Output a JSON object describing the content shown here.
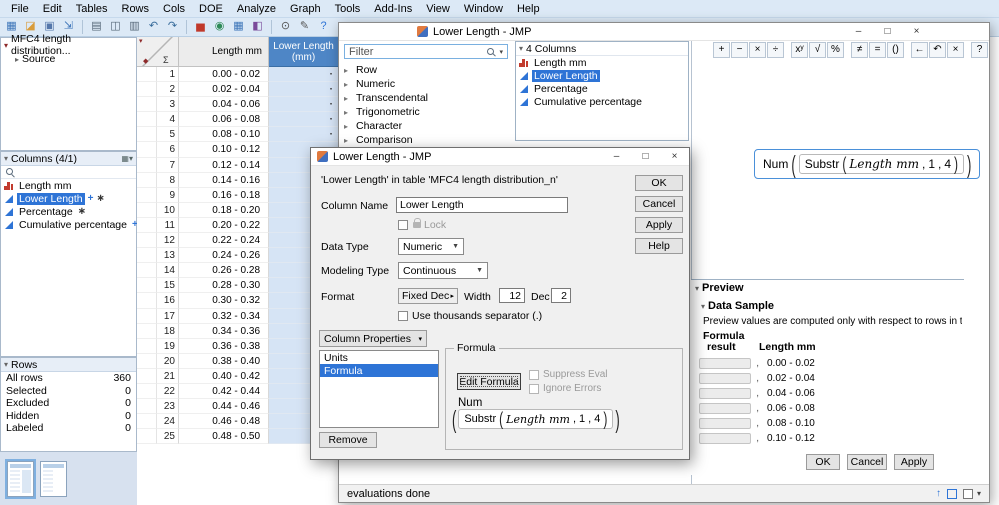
{
  "menubar": {
    "items": [
      "File",
      "Edit",
      "Tables",
      "Rows",
      "Cols",
      "DOE",
      "Analyze",
      "Graph",
      "Tools",
      "Add-Ins",
      "View",
      "Window",
      "Help"
    ]
  },
  "toolbar": {
    "icons": [
      "new-data-table",
      "open",
      "save",
      "import",
      "print",
      "copy",
      "paste",
      "undo",
      "redo",
      "distribution",
      "fit-y-by-x",
      "tabulate",
      "graph-builder",
      "zoom",
      "annotate",
      "help"
    ]
  },
  "sidebar": {
    "table_panel": {
      "title": "MFC4 length distribution...",
      "source_label": "Source"
    },
    "columns_panel": {
      "title": "Columns (4/1)",
      "items": [
        {
          "label": "Length mm",
          "icon": "histogram",
          "selected": false,
          "badges": ""
        },
        {
          "label": "Lower Length",
          "icon": "continuous",
          "selected": true,
          "badges": "+*"
        },
        {
          "label": "Percentage",
          "icon": "continuous",
          "selected": false,
          "badges": "*"
        },
        {
          "label": "Cumulative percentage",
          "icon": "continuous",
          "selected": false,
          "badges": "+*"
        }
      ]
    },
    "rows_panel": {
      "title": "Rows",
      "stats": [
        {
          "label": "All rows",
          "value": "360"
        },
        {
          "label": "Selected",
          "value": "0"
        },
        {
          "label": "Excluded",
          "value": "0"
        },
        {
          "label": "Hidden",
          "value": "0"
        },
        {
          "label": "Labeled",
          "value": "0"
        }
      ]
    }
  },
  "grid": {
    "corner_sigma": "Σ",
    "missing_marker": "·",
    "columns": [
      {
        "label": "Length mm"
      },
      {
        "label": "Lower Length (mm)"
      }
    ],
    "rows": [
      {
        "n": "1",
        "length_mm": "0.00 - 0.02"
      },
      {
        "n": "2",
        "length_mm": "0.02 - 0.04"
      },
      {
        "n": "3",
        "length_mm": "0.04 - 0.06"
      },
      {
        "n": "4",
        "length_mm": "0.06 - 0.08"
      },
      {
        "n": "5",
        "length_mm": "0.08 - 0.10"
      },
      {
        "n": "6",
        "length_mm": "0.10 - 0.12"
      },
      {
        "n": "7",
        "length_mm": "0.12 - 0.14"
      },
      {
        "n": "8",
        "length_mm": "0.14 - 0.16"
      },
      {
        "n": "9",
        "length_mm": "0.16 - 0.18"
      },
      {
        "n": "10",
        "length_mm": "0.18 - 0.20"
      },
      {
        "n": "11",
        "length_mm": "0.20 - 0.22"
      },
      {
        "n": "12",
        "length_mm": "0.22 - 0.24"
      },
      {
        "n": "13",
        "length_mm": "0.24 - 0.26"
      },
      {
        "n": "14",
        "length_mm": "0.26 - 0.28"
      },
      {
        "n": "15",
        "length_mm": "0.28 - 0.30"
      },
      {
        "n": "16",
        "length_mm": "0.30 - 0.32"
      },
      {
        "n": "17",
        "length_mm": "0.32 - 0.34"
      },
      {
        "n": "18",
        "length_mm": "0.34 - 0.36"
      },
      {
        "n": "19",
        "length_mm": "0.36 - 0.38"
      },
      {
        "n": "20",
        "length_mm": "0.38 - 0.40"
      },
      {
        "n": "21",
        "length_mm": "0.40 - 0.42"
      },
      {
        "n": "22",
        "length_mm": "0.42 - 0.44"
      },
      {
        "n": "23",
        "length_mm": "0.44 - 0.46"
      },
      {
        "n": "24",
        "length_mm": "0.46 - 0.48"
      },
      {
        "n": "25",
        "length_mm": "0.48 - 0.50"
      }
    ]
  },
  "formula_window": {
    "title": "Lower Length - JMP",
    "filter_placeholder": "Filter",
    "function_groups": [
      "Row",
      "Numeric",
      "Transcendental",
      "Trigonometric",
      "Character",
      "Comparison"
    ],
    "columns_header": "4 Columns",
    "columns": [
      {
        "label": "Length mm",
        "icon": "histogram",
        "selected": false
      },
      {
        "label": "Lower Length",
        "icon": "continuous",
        "selected": true
      },
      {
        "label": "Percentage",
        "icon": "continuous",
        "selected": false
      },
      {
        "label": "Cumulative percentage",
        "icon": "continuous",
        "selected": false
      }
    ],
    "toolbar_icons": [
      "plus",
      "minus",
      "times",
      "divide",
      "power",
      "root",
      "percent",
      "not-equal",
      "equal",
      "brackets",
      "backspace",
      "undo",
      "clear",
      "help"
    ],
    "formula": {
      "outer_fn": "Num",
      "inner_fn": "Substr",
      "column_arg": "Length mm",
      "arg2": "1",
      "arg3": "4"
    },
    "status": "evaluations done"
  },
  "column_dialog": {
    "title": "Lower Length - JMP",
    "context_line": "'Lower Length' in table 'MFC4 length distribution_n'",
    "fields": {
      "column_name_label": "Column Name",
      "column_name_value": "Lower Length",
      "lock_label": "Lock",
      "data_type_label": "Data Type",
      "data_type_value": "Numeric",
      "modeling_type_label": "Modeling Type",
      "modeling_type_value": "Continuous",
      "format_label": "Format",
      "format_value": "Fixed Dec",
      "width_label": "Width",
      "width_value": "12",
      "dec_label": "Dec",
      "dec_value": "2",
      "thousands_label": "Use thousands separator (.)",
      "column_properties_label": "Column Properties"
    },
    "properties_list": [
      {
        "label": "Units",
        "selected": false
      },
      {
        "label": "Formula",
        "selected": true
      }
    ],
    "formula_group": {
      "legend": "Formula",
      "edit_button": "Edit Formula",
      "suppress_eval": "Suppress Eval",
      "ignore_errors": "Ignore Errors"
    },
    "remove_button": "Remove",
    "side_buttons": [
      "OK",
      "Cancel",
      "Apply",
      "Help"
    ]
  },
  "preview": {
    "title": "Preview",
    "sample_title": "Data Sample",
    "note": "Preview values are computed only with respect to rows in the sa",
    "result_header_line1": "Formula",
    "result_header_line2": "result",
    "column_header": "Length mm",
    "pending_marker": ",",
    "rows": [
      "0.00 - 0.02",
      "0.02 - 0.04",
      "0.04 - 0.06",
      "0.06 - 0.08",
      "0.08 - 0.10",
      "0.10 - 0.12"
    ],
    "buttons": [
      "OK",
      "Cancel",
      "Apply"
    ]
  }
}
